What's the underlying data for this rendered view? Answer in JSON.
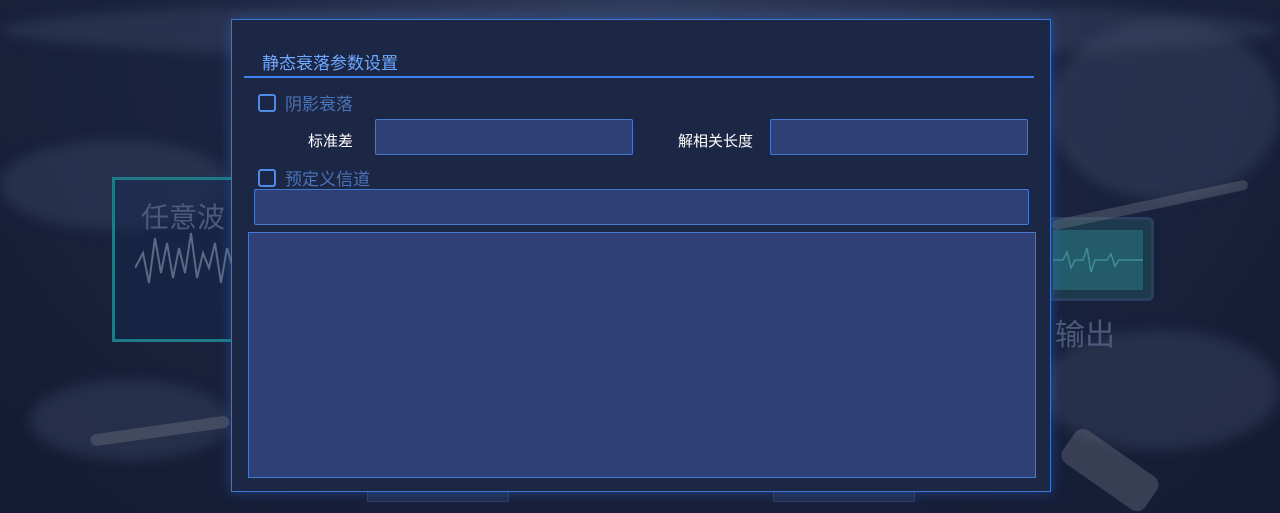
{
  "background": {
    "left_card_label": "任意波",
    "right_card_label": "输出"
  },
  "dialog": {
    "title": "静态衰落参数设置",
    "shadow_fading": {
      "label": "阴影衰落",
      "checked": false,
      "std_dev_label": "标准差",
      "std_dev_value": "",
      "decorrelation_length_label": "解相关长度",
      "decorrelation_length_value": ""
    },
    "predefined_channel": {
      "label": "预定义信道",
      "checked": false,
      "select_value": "",
      "details": ""
    }
  },
  "colors": {
    "accent": "#3b82f0",
    "title": "#6ea8ff",
    "input_bg": "#2e4075",
    "dialog_bg": "#1c2645"
  }
}
